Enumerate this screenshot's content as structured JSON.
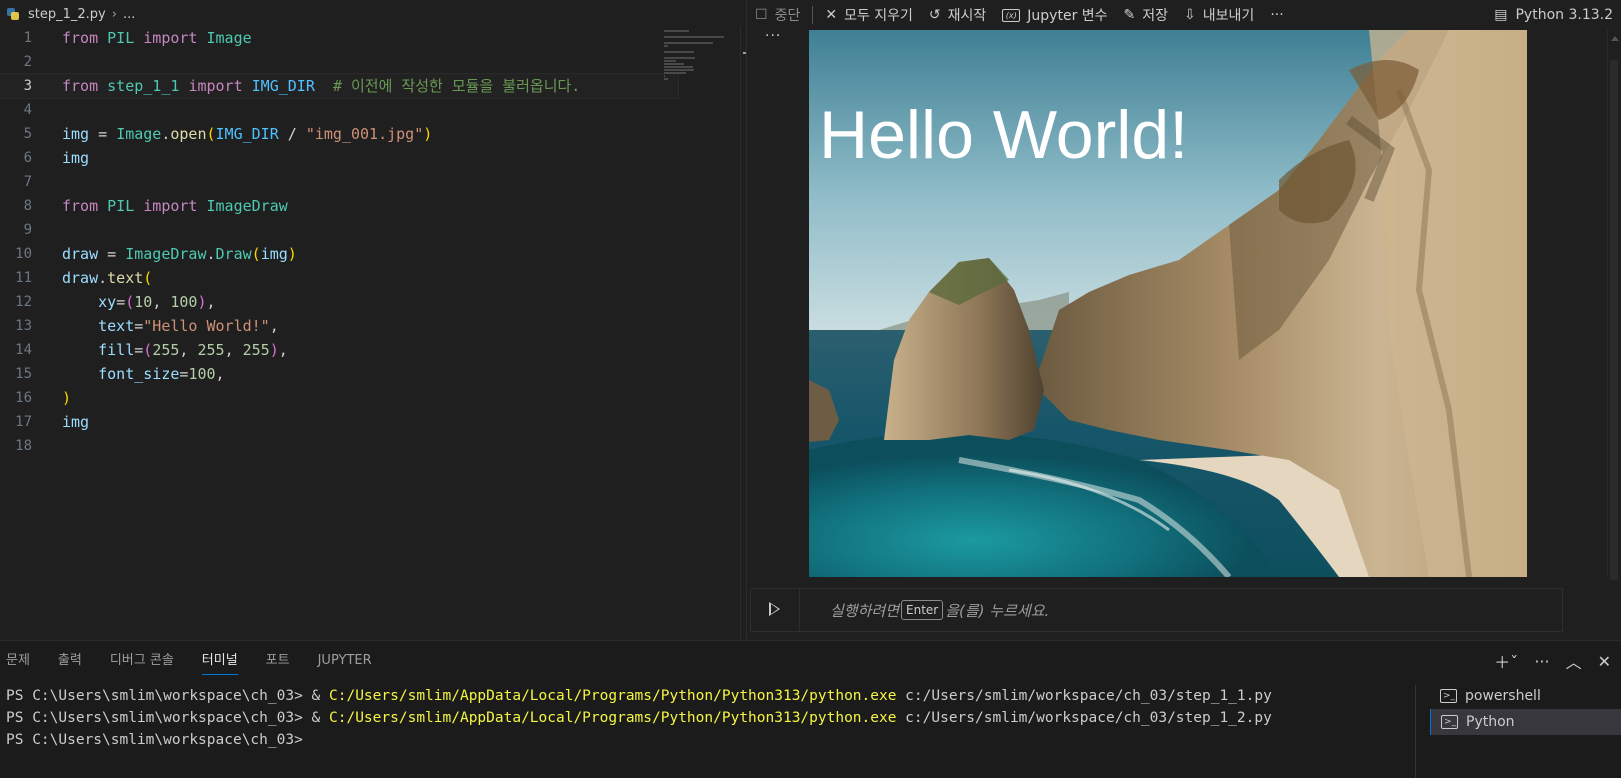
{
  "breadcrumb": {
    "file": "step_1_2.py",
    "more": "..."
  },
  "code_lines": [
    [
      {
        "t": "from",
        "c": "kw"
      },
      {
        "t": " "
      },
      {
        "t": "PIL",
        "c": "mod"
      },
      {
        "t": " "
      },
      {
        "t": "import",
        "c": "kw"
      },
      {
        "t": " "
      },
      {
        "t": "Image",
        "c": "cls"
      }
    ],
    [],
    [
      {
        "t": "from",
        "c": "kw"
      },
      {
        "t": " "
      },
      {
        "t": "step_1_1",
        "c": "mod"
      },
      {
        "t": " "
      },
      {
        "t": "import",
        "c": "kw"
      },
      {
        "t": " "
      },
      {
        "t": "IMG_DIR",
        "c": "const"
      },
      {
        "t": "  "
      },
      {
        "t": "# 이전에 작성한 모듈을 불러옵니다.",
        "c": "cmt"
      }
    ],
    [],
    [
      {
        "t": "img",
        "c": "var"
      },
      {
        "t": " = ",
        "c": "op"
      },
      {
        "t": "Image",
        "c": "cls"
      },
      {
        "t": "."
      },
      {
        "t": "open",
        "c": "fn"
      },
      {
        "t": "(",
        "c": "br1"
      },
      {
        "t": "IMG_DIR",
        "c": "const"
      },
      {
        "t": " / ",
        "c": "op"
      },
      {
        "t": "\"img_001.jpg\"",
        "c": "str"
      },
      {
        "t": ")",
        "c": "br1"
      }
    ],
    [
      {
        "t": "img",
        "c": "var"
      }
    ],
    [],
    [
      {
        "t": "from",
        "c": "kw"
      },
      {
        "t": " "
      },
      {
        "t": "PIL",
        "c": "mod"
      },
      {
        "t": " "
      },
      {
        "t": "import",
        "c": "kw"
      },
      {
        "t": " "
      },
      {
        "t": "ImageDraw",
        "c": "cls"
      }
    ],
    [],
    [
      {
        "t": "draw",
        "c": "var"
      },
      {
        "t": " = ",
        "c": "op"
      },
      {
        "t": "ImageDraw",
        "c": "cls"
      },
      {
        "t": "."
      },
      {
        "t": "Draw",
        "c": "cls"
      },
      {
        "t": "(",
        "c": "br1"
      },
      {
        "t": "img",
        "c": "var"
      },
      {
        "t": ")",
        "c": "br1"
      }
    ],
    [
      {
        "t": "draw",
        "c": "var"
      },
      {
        "t": "."
      },
      {
        "t": "text",
        "c": "fn"
      },
      {
        "t": "(",
        "c": "br1"
      }
    ],
    [
      {
        "t": "    "
      },
      {
        "t": "xy",
        "c": "var"
      },
      {
        "t": "=",
        "c": "op"
      },
      {
        "t": "(",
        "c": "br2"
      },
      {
        "t": "10",
        "c": "num"
      },
      {
        "t": ", "
      },
      {
        "t": "100",
        "c": "num"
      },
      {
        "t": ")",
        "c": "br2"
      },
      {
        "t": ","
      }
    ],
    [
      {
        "t": "    "
      },
      {
        "t": "text",
        "c": "var"
      },
      {
        "t": "=",
        "c": "op"
      },
      {
        "t": "\"Hello World!\"",
        "c": "str"
      },
      {
        "t": ","
      }
    ],
    [
      {
        "t": "    "
      },
      {
        "t": "fill",
        "c": "var"
      },
      {
        "t": "=",
        "c": "op"
      },
      {
        "t": "(",
        "c": "br2"
      },
      {
        "t": "255",
        "c": "num"
      },
      {
        "t": ", "
      },
      {
        "t": "255",
        "c": "num"
      },
      {
        "t": ", "
      },
      {
        "t": "255",
        "c": "num"
      },
      {
        "t": ")",
        "c": "br2"
      },
      {
        "t": ","
      }
    ],
    [
      {
        "t": "    "
      },
      {
        "t": "font_size",
        "c": "var"
      },
      {
        "t": "=",
        "c": "op"
      },
      {
        "t": "100",
        "c": "num"
      },
      {
        "t": ","
      }
    ],
    [
      {
        "t": ")",
        "c": "br1"
      }
    ],
    [
      {
        "t": "img",
        "c": "var"
      }
    ],
    []
  ],
  "current_line": 3,
  "jupyter_toolbar": {
    "interrupt": "중단",
    "clear_all": "모두 지우기",
    "restart": "재시작",
    "variables": "Jupyter 변수",
    "save": "저장",
    "export": "내보내기",
    "more": "···",
    "kernel": "Python 3.13.2"
  },
  "output": {
    "overlay_text": "Hello World!"
  },
  "input_cell": {
    "hint_before": "실행하려면",
    "key": "Enter",
    "hint_after": "을(를) 누르세요."
  },
  "panel": {
    "tabs": [
      "문제",
      "출력",
      "디버그 콘솔",
      "터미널",
      "포트",
      "JUPYTER"
    ],
    "active_tab": 3
  },
  "terminal": {
    "lines": [
      {
        "prompt": "PS C:\\Users\\smlim\\workspace\\ch_03> ",
        "amp": "& ",
        "exe": "C:/Users/smlim/AppData/Local/Programs/Python/Python313/python.exe",
        "arg": " c:/Users/smlim/workspace/ch_03/step_1_1.py"
      },
      {
        "prompt": "PS C:\\Users\\smlim\\workspace\\ch_03> ",
        "amp": "& ",
        "exe": "C:/Users/smlim/AppData/Local/Programs/Python/Python313/python.exe",
        "arg": " c:/Users/smlim/workspace/ch_03/step_1_2.py"
      },
      {
        "prompt": "PS C:\\Users\\smlim\\workspace\\ch_03>",
        "amp": "",
        "exe": "",
        "arg": ""
      }
    ],
    "sessions": [
      "powershell",
      "Python"
    ],
    "active_session": 1
  },
  "colors": {
    "accent": "#0078d4",
    "terminal_path": "#f5f543",
    "editor_bg": "#1f1f1f"
  }
}
